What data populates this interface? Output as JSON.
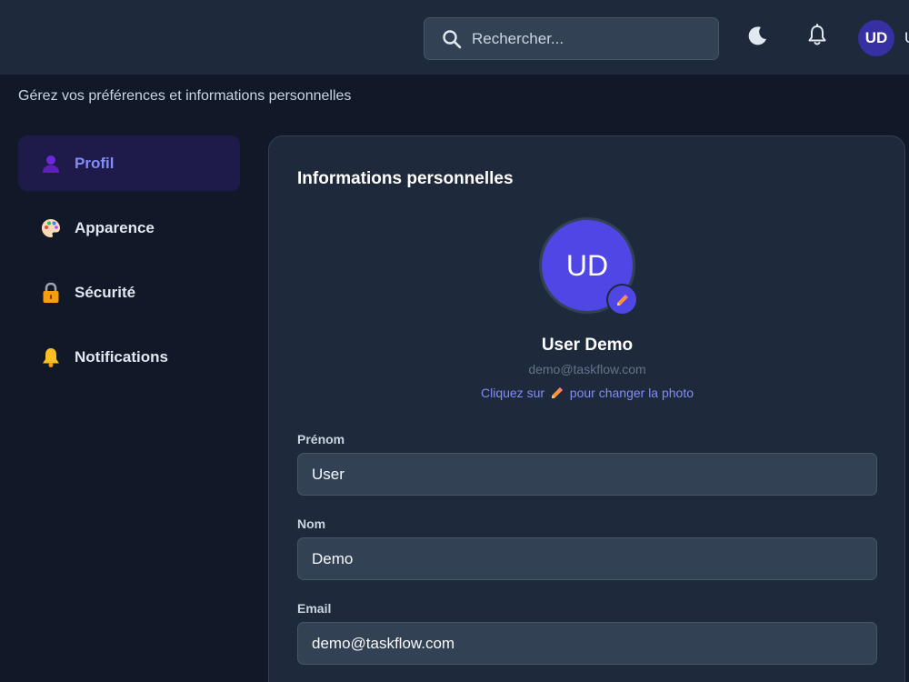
{
  "header": {
    "search": {
      "placeholder": "Rechercher..."
    },
    "icons": [
      "moon-icon",
      "bell-icon"
    ],
    "user": {
      "initials": "UD",
      "name_cut": "U"
    }
  },
  "page": {
    "subtitle": "Gérez vos préférences et informations personnelles"
  },
  "sidebar": {
    "items": [
      {
        "label": "Profil",
        "icon": "user-icon",
        "active": true
      },
      {
        "label": "Apparence",
        "icon": "palette-icon",
        "active": false
      },
      {
        "label": "Sécurité",
        "icon": "lock-icon",
        "active": false
      },
      {
        "label": "Notifications",
        "icon": "bell-icon",
        "active": false
      }
    ]
  },
  "profile": {
    "title": "Informations personnelles",
    "initials": "UD",
    "name": "User Demo",
    "email": "demo@taskflow.com",
    "photo_hint_before": "Cliquez sur",
    "photo_hint_after": "pour changer la photo"
  },
  "form": {
    "first_name": {
      "label": "Prénom",
      "value": "User"
    },
    "last_name": {
      "label": "Nom",
      "value": "Demo"
    },
    "email": {
      "label": "Email",
      "value": "demo@taskflow.com"
    }
  },
  "colors": {
    "background": "#111827",
    "panel": "#1e293b",
    "input": "#334155",
    "accent": "#4f46e5",
    "accent_text": "#818cf8"
  }
}
